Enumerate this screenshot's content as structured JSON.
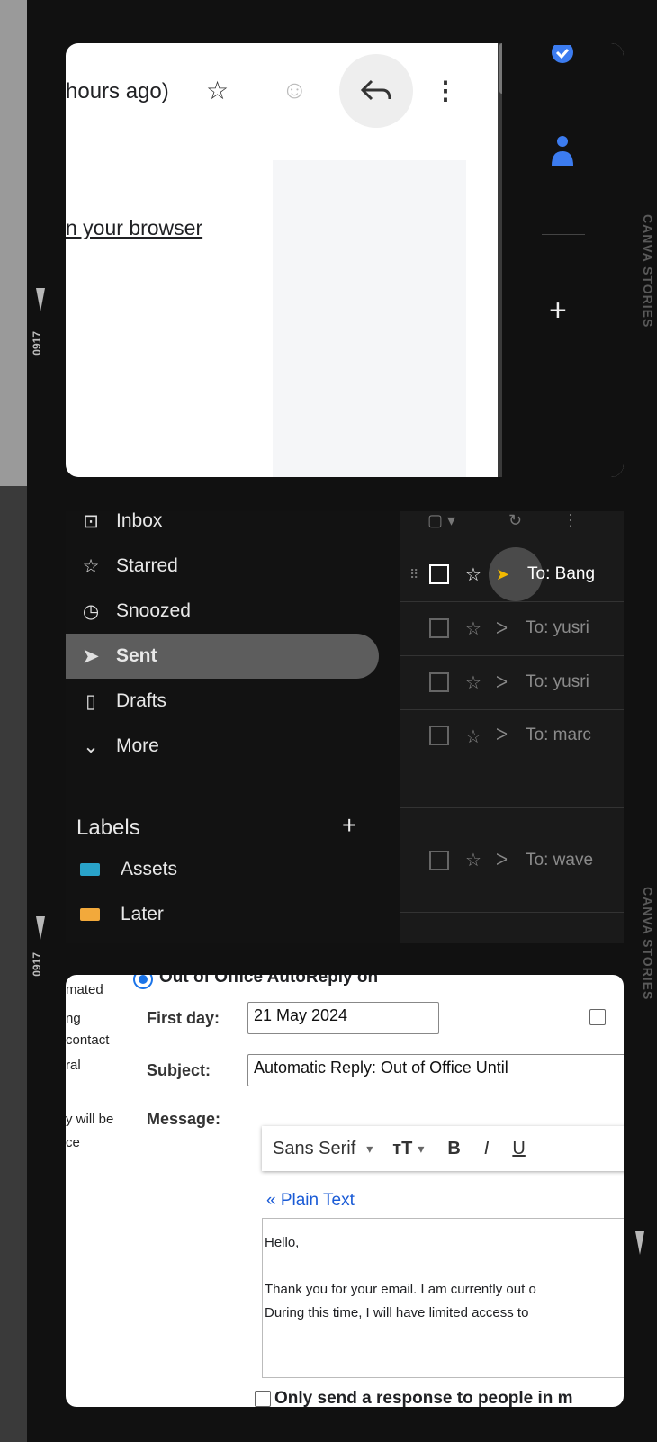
{
  "film": {
    "brand": "CANVA STORIES",
    "frame_number": "0917"
  },
  "email_view": {
    "time_fragment": "hours ago)",
    "link_fragment": "n your browser"
  },
  "sidebar": {
    "items": [
      {
        "label": "Inbox",
        "icon": "inbox-icon"
      },
      {
        "label": "Starred",
        "icon": "star-icon"
      },
      {
        "label": "Snoozed",
        "icon": "clock-icon"
      },
      {
        "label": "Sent",
        "icon": "send-icon"
      },
      {
        "label": "Drafts",
        "icon": "draft-icon"
      },
      {
        "label": "More",
        "icon": "chevron-down-icon"
      }
    ],
    "labels_heading": "Labels",
    "labels": [
      {
        "name": "Assets",
        "color": "#29a3c9"
      },
      {
        "name": "Later",
        "color": "#f2a93b"
      }
    ]
  },
  "message_list": {
    "rows": [
      {
        "to": "To: Bang"
      },
      {
        "to": "To: yusri"
      },
      {
        "to": "To: yusri"
      },
      {
        "to": "To: marc"
      },
      {
        "to": "To: wave"
      }
    ]
  },
  "vacation": {
    "radio_label": "Out of Office AutoReply on",
    "side_text": [
      "mated",
      "ng",
      "contact",
      "ral",
      "y will be",
      "ce"
    ],
    "first_day_label": "First day:",
    "first_day_value": "21 May 2024",
    "subject_label": "Subject:",
    "subject_value": "Automatic Reply: Out of Office Until",
    "message_label": "Message:",
    "font_name": "Sans Serif",
    "plain_text_link": "« Plain Text",
    "message_lines": [
      "Hello,",
      "",
      "Thank you for your email. I am currently out o",
      "During this time, I will have limited access to"
    ],
    "only_send": "Only send a response to people in m"
  }
}
